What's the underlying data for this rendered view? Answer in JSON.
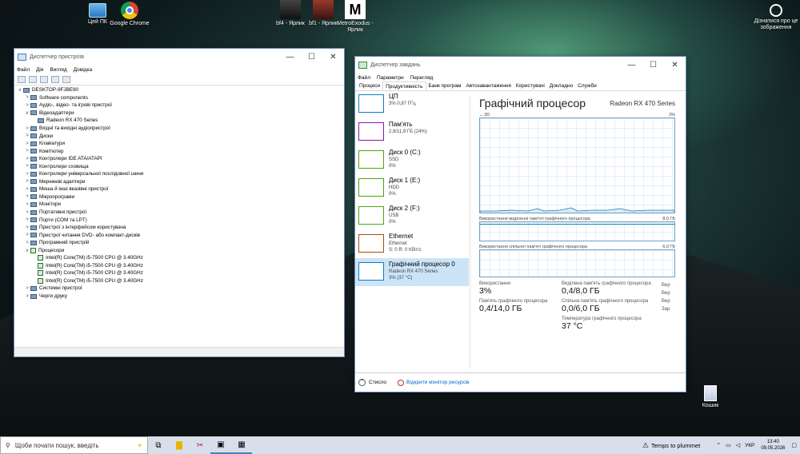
{
  "desktop": {
    "icons": [
      {
        "label": "Цей ПК"
      },
      {
        "label": "Google Chrome"
      },
      {
        "label": "bf4 - Ярлик"
      },
      {
        "label": "bf1 - Ярлик"
      },
      {
        "label": "MetroExodus - Ярлик"
      },
      {
        "label": "Дізнатися про це зображення"
      },
      {
        "label": "Кошик"
      }
    ]
  },
  "devmgr": {
    "title": "Диспетчер пристроїв",
    "menu": [
      "Файл",
      "Дія",
      "Вигляд",
      "Довідка"
    ],
    "tree": [
      {
        "label": "DESKTOP-9FJBE90",
        "depth": 0,
        "arrow": "∨",
        "icon": "computer"
      },
      {
        "label": "Software components",
        "depth": 1,
        "arrow": ">",
        "icon": "node"
      },
      {
        "label": "Аудіо-, відео- та ігрові пристрої",
        "depth": 1,
        "arrow": ">",
        "icon": "node"
      },
      {
        "label": "Відеоадаптери",
        "depth": 1,
        "arrow": "∨",
        "icon": "node"
      },
      {
        "label": "Radeon RX 470 Series",
        "depth": 2,
        "arrow": "",
        "icon": "node"
      },
      {
        "label": "Вхідні та вихідні аудіопристрої",
        "depth": 1,
        "arrow": ">",
        "icon": "node"
      },
      {
        "label": "Диски",
        "depth": 1,
        "arrow": ">",
        "icon": "node"
      },
      {
        "label": "Клавіатури",
        "depth": 1,
        "arrow": ">",
        "icon": "node"
      },
      {
        "label": "Комп'ютер",
        "depth": 1,
        "arrow": ">",
        "icon": "node"
      },
      {
        "label": "Контролери IDE ATA/ATAPI",
        "depth": 1,
        "arrow": ">",
        "icon": "node"
      },
      {
        "label": "Контролери сховища",
        "depth": 1,
        "arrow": ">",
        "icon": "node"
      },
      {
        "label": "Контролери універсальної послідовної шини",
        "depth": 1,
        "arrow": ">",
        "icon": "node"
      },
      {
        "label": "Мережеві адаптери",
        "depth": 1,
        "arrow": ">",
        "icon": "node"
      },
      {
        "label": "Миша й інші вказівні пристрої",
        "depth": 1,
        "arrow": ">",
        "icon": "node"
      },
      {
        "label": "Мікропрограми",
        "depth": 1,
        "arrow": ">",
        "icon": "node"
      },
      {
        "label": "Монітори",
        "depth": 1,
        "arrow": ">",
        "icon": "node"
      },
      {
        "label": "Портативні пристрої",
        "depth": 1,
        "arrow": ">",
        "icon": "node"
      },
      {
        "label": "Порти (COM та LPT)",
        "depth": 1,
        "arrow": ">",
        "icon": "node"
      },
      {
        "label": "Пристрої з інтерфейсом користувача",
        "depth": 1,
        "arrow": ">",
        "icon": "node"
      },
      {
        "label": "Пристрої читання DVD- або компакт-дисків",
        "depth": 1,
        "arrow": ">",
        "icon": "node"
      },
      {
        "label": "Програмний пристрій",
        "depth": 1,
        "arrow": ">",
        "icon": "node"
      },
      {
        "label": "Процесори",
        "depth": 1,
        "arrow": "∨",
        "icon": "cpu"
      },
      {
        "label": "Intel(R) Core(TM) i5-7500 CPU @ 3.40GHz",
        "depth": 2,
        "arrow": "",
        "icon": "cpu"
      },
      {
        "label": "Intel(R) Core(TM) i5-7500 CPU @ 3.40GHz",
        "depth": 2,
        "arrow": "",
        "icon": "cpu"
      },
      {
        "label": "Intel(R) Core(TM) i5-7500 CPU @ 3.40GHz",
        "depth": 2,
        "arrow": "",
        "icon": "cpu"
      },
      {
        "label": "Intel(R) Core(TM) i5-7500 CPU @ 3.40GHz",
        "depth": 2,
        "arrow": "",
        "icon": "cpu"
      },
      {
        "label": "Системні пристрої",
        "depth": 1,
        "arrow": ">",
        "icon": "node"
      },
      {
        "label": "Черги друку",
        "depth": 1,
        "arrow": ">",
        "icon": "node"
      }
    ]
  },
  "taskmgr": {
    "title": "Диспетчер завдань",
    "menu": [
      "Файл",
      "Параметри",
      "Перегляд"
    ],
    "tabs": [
      "Процеси",
      "Продуктивність",
      "Банк програм",
      "Автозавантаження",
      "Користувачі",
      "Докладно",
      "Служби"
    ],
    "active_tab": 1,
    "side": [
      {
        "name": "ЦП",
        "sub1": "3% 0,87 ГГц",
        "sub2": "",
        "sub3": "",
        "color": "#117dbb"
      },
      {
        "name": "Пам'ять",
        "sub1": "2,9/11,9 ГБ (24%)",
        "sub2": "",
        "sub3": "",
        "color": "#8b12ae"
      },
      {
        "name": "Диск 0 (C:)",
        "sub1": "SSD",
        "sub2": "0%",
        "sub3": "",
        "color": "#4da60c"
      },
      {
        "name": "Диск 1 (E:)",
        "sub1": "HDD",
        "sub2": "0%",
        "sub3": "",
        "color": "#4da60c"
      },
      {
        "name": "Диск 2 (F:)",
        "sub1": "USB",
        "sub2": "0%",
        "sub3": "",
        "color": "#4da60c"
      },
      {
        "name": "Ethernet",
        "sub1": "Ethernet",
        "sub2": "S: 0 R: 0 Кбіт/с",
        "sub3": "",
        "color": "#a74f01"
      },
      {
        "name": "Графічний процесор 0",
        "sub1": "Radeon RX 470 Series",
        "sub2": "3% (37 °C)",
        "sub3": "",
        "color": "#117dbb"
      }
    ],
    "gpu": {
      "title": "Графічний процесор",
      "model": "Radeon RX 470 Series",
      "engine_label": "3D",
      "engine_pct": "3%",
      "dedicated_label": "Використання виділеної пам'яті графічного процесора",
      "dedicated_max": "8,0 ГБ",
      "shared_label": "Використання спільної пам'яті графічного процесора",
      "shared_max": "6,0 ГБ",
      "stats": {
        "usage_label": "Використання",
        "usage_value": "3%",
        "mem_label": "Пам'ять графічного процесора",
        "mem_value": "0,4/14,0 ГБ",
        "ded_label": "Виділена пам'ять графічного процесора",
        "ded_value": "0,4/8,0 ГБ",
        "shr_label": "Спільна пам'ять графічного процесора",
        "shr_value": "0,0/6,0 ГБ",
        "temp_label": "Температура графічного процесора",
        "temp_value": "37 °C",
        "right_col": [
          "Вер",
          "Вер",
          "Вер",
          "Зар"
        ]
      }
    },
    "footer": {
      "less": "Стисло",
      "monitor": "Відкрити монітор ресурсів"
    }
  },
  "taskbar": {
    "search_placeholder": "Щоби почати пошук, введіть",
    "weather": "Temps to plummet",
    "lang": "УКР",
    "time": "13:40",
    "date": "09.05.2026"
  }
}
